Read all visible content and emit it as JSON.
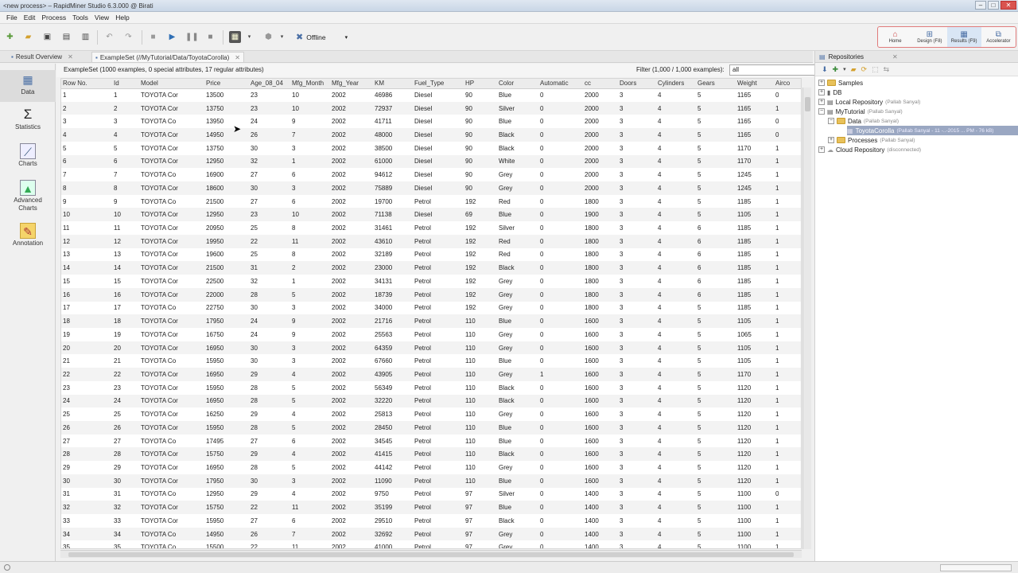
{
  "window": {
    "title": "<new process> – RapidMiner Studio 6.3.000 @ Birati"
  },
  "menu": [
    "File",
    "Edit",
    "Process",
    "Tools",
    "View",
    "Help"
  ],
  "toolbar": {
    "offline_label": "Offline"
  },
  "perspectives": [
    {
      "label": "Home",
      "icon": "home-icon"
    },
    {
      "label": "Design (F8)",
      "icon": "design-icon"
    },
    {
      "label": "Results (F9)",
      "icon": "results-icon"
    },
    {
      "label": "Accelerator",
      "icon": "accelerator-icon"
    }
  ],
  "tabs": [
    {
      "label": "Result Overview"
    },
    {
      "label": "ExampleSet (//MyTutorial/Data/ToyotaCorolla)"
    }
  ],
  "left_nav": [
    {
      "label": "Data",
      "icon": "data-icon"
    },
    {
      "label": "Statistics",
      "icon": "sigma-icon"
    },
    {
      "label": "Charts",
      "icon": "chart-icon"
    },
    {
      "label": "Advanced Charts",
      "icon": "advanced-chart-icon"
    },
    {
      "label": "Annotation",
      "icon": "annotation-icon"
    }
  ],
  "exampleset": {
    "info": "ExampleSet (1000 examples, 0 special attributes, 17 regular attributes)",
    "filter_label": "Filter (1,000 / 1,000 examples):",
    "filter_value": "all"
  },
  "table": {
    "columns": [
      "Row No.",
      "Id",
      "Model",
      "Price",
      "Age_08_04",
      "Mfg_Month",
      "Mfg_Year",
      "KM",
      "Fuel_Type",
      "HP",
      "Color",
      "Automatic",
      "cc",
      "Doors",
      "Cylinders",
      "Gears",
      "Weight",
      "Airco"
    ],
    "rows": [
      [
        "1",
        "1",
        "TOYOTA Cor",
        "13500",
        "23",
        "10",
        "2002",
        "46986",
        "Diesel",
        "90",
        "Blue",
        "0",
        "2000",
        "3",
        "4",
        "5",
        "1165",
        "0"
      ],
      [
        "2",
        "2",
        "TOYOTA Cor",
        "13750",
        "23",
        "10",
        "2002",
        "72937",
        "Diesel",
        "90",
        "Silver",
        "0",
        "2000",
        "3",
        "4",
        "5",
        "1165",
        "1"
      ],
      [
        "3",
        "3",
        "TOYOTA Co",
        "13950",
        "24",
        "9",
        "2002",
        "41711",
        "Diesel",
        "90",
        "Blue",
        "0",
        "2000",
        "3",
        "4",
        "5",
        "1165",
        "0"
      ],
      [
        "4",
        "4",
        "TOYOTA Cor",
        "14950",
        "26",
        "7",
        "2002",
        "48000",
        "Diesel",
        "90",
        "Black",
        "0",
        "2000",
        "3",
        "4",
        "5",
        "1165",
        "0"
      ],
      [
        "5",
        "5",
        "TOYOTA Cor",
        "13750",
        "30",
        "3",
        "2002",
        "38500",
        "Diesel",
        "90",
        "Black",
        "0",
        "2000",
        "3",
        "4",
        "5",
        "1170",
        "1"
      ],
      [
        "6",
        "6",
        "TOYOTA Cor",
        "12950",
        "32",
        "1",
        "2002",
        "61000",
        "Diesel",
        "90",
        "White",
        "0",
        "2000",
        "3",
        "4",
        "5",
        "1170",
        "1"
      ],
      [
        "7",
        "7",
        "TOYOTA Co",
        "16900",
        "27",
        "6",
        "2002",
        "94612",
        "Diesel",
        "90",
        "Grey",
        "0",
        "2000",
        "3",
        "4",
        "5",
        "1245",
        "1"
      ],
      [
        "8",
        "8",
        "TOYOTA Cor",
        "18600",
        "30",
        "3",
        "2002",
        "75889",
        "Diesel",
        "90",
        "Grey",
        "0",
        "2000",
        "3",
        "4",
        "5",
        "1245",
        "1"
      ],
      [
        "9",
        "9",
        "TOYOTA Co",
        "21500",
        "27",
        "6",
        "2002",
        "19700",
        "Petrol",
        "192",
        "Red",
        "0",
        "1800",
        "3",
        "4",
        "5",
        "1185",
        "1"
      ],
      [
        "10",
        "10",
        "TOYOTA Cor",
        "12950",
        "23",
        "10",
        "2002",
        "71138",
        "Diesel",
        "69",
        "Blue",
        "0",
        "1900",
        "3",
        "4",
        "5",
        "1105",
        "1"
      ],
      [
        "11",
        "11",
        "TOYOTA Cor",
        "20950",
        "25",
        "8",
        "2002",
        "31461",
        "Petrol",
        "192",
        "Silver",
        "0",
        "1800",
        "3",
        "4",
        "6",
        "1185",
        "1"
      ],
      [
        "12",
        "12",
        "TOYOTA Cor",
        "19950",
        "22",
        "11",
        "2002",
        "43610",
        "Petrol",
        "192",
        "Red",
        "0",
        "1800",
        "3",
        "4",
        "6",
        "1185",
        "1"
      ],
      [
        "13",
        "13",
        "TOYOTA Cor",
        "19600",
        "25",
        "8",
        "2002",
        "32189",
        "Petrol",
        "192",
        "Red",
        "0",
        "1800",
        "3",
        "4",
        "6",
        "1185",
        "1"
      ],
      [
        "14",
        "14",
        "TOYOTA Cor",
        "21500",
        "31",
        "2",
        "2002",
        "23000",
        "Petrol",
        "192",
        "Black",
        "0",
        "1800",
        "3",
        "4",
        "6",
        "1185",
        "1"
      ],
      [
        "15",
        "15",
        "TOYOTA Cor",
        "22500",
        "32",
        "1",
        "2002",
        "34131",
        "Petrol",
        "192",
        "Grey",
        "0",
        "1800",
        "3",
        "4",
        "6",
        "1185",
        "1"
      ],
      [
        "16",
        "16",
        "TOYOTA Cor",
        "22000",
        "28",
        "5",
        "2002",
        "18739",
        "Petrol",
        "192",
        "Grey",
        "0",
        "1800",
        "3",
        "4",
        "6",
        "1185",
        "1"
      ],
      [
        "17",
        "17",
        "TOYOTA Co",
        "22750",
        "30",
        "3",
        "2002",
        "34000",
        "Petrol",
        "192",
        "Grey",
        "0",
        "1800",
        "3",
        "4",
        "5",
        "1185",
        "1"
      ],
      [
        "18",
        "18",
        "TOYOTA Cor",
        "17950",
        "24",
        "9",
        "2002",
        "21716",
        "Petrol",
        "110",
        "Blue",
        "0",
        "1600",
        "3",
        "4",
        "5",
        "1105",
        "1"
      ],
      [
        "19",
        "19",
        "TOYOTA Cor",
        "16750",
        "24",
        "9",
        "2002",
        "25563",
        "Petrol",
        "110",
        "Grey",
        "0",
        "1600",
        "3",
        "4",
        "5",
        "1065",
        "1"
      ],
      [
        "20",
        "20",
        "TOYOTA Cor",
        "16950",
        "30",
        "3",
        "2002",
        "64359",
        "Petrol",
        "110",
        "Grey",
        "0",
        "1600",
        "3",
        "4",
        "5",
        "1105",
        "1"
      ],
      [
        "21",
        "21",
        "TOYOTA Co",
        "15950",
        "30",
        "3",
        "2002",
        "67660",
        "Petrol",
        "110",
        "Blue",
        "0",
        "1600",
        "3",
        "4",
        "5",
        "1105",
        "1"
      ],
      [
        "22",
        "22",
        "TOYOTA Cor",
        "16950",
        "29",
        "4",
        "2002",
        "43905",
        "Petrol",
        "110",
        "Grey",
        "1",
        "1600",
        "3",
        "4",
        "5",
        "1170",
        "1"
      ],
      [
        "23",
        "23",
        "TOYOTA Cor",
        "15950",
        "28",
        "5",
        "2002",
        "56349",
        "Petrol",
        "110",
        "Black",
        "0",
        "1600",
        "3",
        "4",
        "5",
        "1120",
        "1"
      ],
      [
        "24",
        "24",
        "TOYOTA Cor",
        "16950",
        "28",
        "5",
        "2002",
        "32220",
        "Petrol",
        "110",
        "Black",
        "0",
        "1600",
        "3",
        "4",
        "5",
        "1120",
        "1"
      ],
      [
        "25",
        "25",
        "TOYOTA Cor",
        "16250",
        "29",
        "4",
        "2002",
        "25813",
        "Petrol",
        "110",
        "Grey",
        "0",
        "1600",
        "3",
        "4",
        "5",
        "1120",
        "1"
      ],
      [
        "26",
        "26",
        "TOYOTA Cor",
        "15950",
        "28",
        "5",
        "2002",
        "28450",
        "Petrol",
        "110",
        "Blue",
        "0",
        "1600",
        "3",
        "4",
        "5",
        "1120",
        "1"
      ],
      [
        "27",
        "27",
        "TOYOTA Co",
        "17495",
        "27",
        "6",
        "2002",
        "34545",
        "Petrol",
        "110",
        "Blue",
        "0",
        "1600",
        "3",
        "4",
        "5",
        "1120",
        "1"
      ],
      [
        "28",
        "28",
        "TOYOTA Cor",
        "15750",
        "29",
        "4",
        "2002",
        "41415",
        "Petrol",
        "110",
        "Black",
        "0",
        "1600",
        "3",
        "4",
        "5",
        "1120",
        "1"
      ],
      [
        "29",
        "29",
        "TOYOTA Cor",
        "16950",
        "28",
        "5",
        "2002",
        "44142",
        "Petrol",
        "110",
        "Grey",
        "0",
        "1600",
        "3",
        "4",
        "5",
        "1120",
        "1"
      ],
      [
        "30",
        "30",
        "TOYOTA Cor",
        "17950",
        "30",
        "3",
        "2002",
        "11090",
        "Petrol",
        "110",
        "Blue",
        "0",
        "1600",
        "3",
        "4",
        "5",
        "1120",
        "1"
      ],
      [
        "31",
        "31",
        "TOYOTA Co",
        "12950",
        "29",
        "4",
        "2002",
        "9750",
        "Petrol",
        "97",
        "Silver",
        "0",
        "1400",
        "3",
        "4",
        "5",
        "1100",
        "0"
      ],
      [
        "32",
        "32",
        "TOYOTA Cor",
        "15750",
        "22",
        "11",
        "2002",
        "35199",
        "Petrol",
        "97",
        "Blue",
        "0",
        "1400",
        "3",
        "4",
        "5",
        "1100",
        "1"
      ],
      [
        "33",
        "33",
        "TOYOTA Cor",
        "15950",
        "27",
        "6",
        "2002",
        "29510",
        "Petrol",
        "97",
        "Black",
        "0",
        "1400",
        "3",
        "4",
        "5",
        "1100",
        "1"
      ],
      [
        "34",
        "34",
        "TOYOTA Co",
        "14950",
        "26",
        "7",
        "2002",
        "32692",
        "Petrol",
        "97",
        "Grey",
        "0",
        "1400",
        "3",
        "4",
        "5",
        "1100",
        "1"
      ],
      [
        "35",
        "35",
        "TOYOTA Co",
        "15500",
        "22",
        "11",
        "2002",
        "41000",
        "Petrol",
        "97",
        "Grey",
        "0",
        "1400",
        "3",
        "4",
        "5",
        "1100",
        "1"
      ]
    ]
  },
  "repositories": {
    "panel_title": "Repositories",
    "tree": [
      {
        "label": "Samples",
        "sub": ""
      },
      {
        "label": "DB",
        "sub": ""
      },
      {
        "label": "Local Repository",
        "sub": "(Pallab Sanyal)"
      },
      {
        "label": "MyTutorial",
        "sub": "(Pallab Sanyal)"
      },
      {
        "label": "Data",
        "sub": "(Pallab Sanyal)"
      },
      {
        "label": "ToyotaCorolla",
        "sub": "(Pallab Sanyal - 11 -..-2015 ... PM - 76 kB)"
      },
      {
        "label": "Processes",
        "sub": "(Pallab Sanyal)"
      },
      {
        "label": "Cloud Repository",
        "sub": "(disconnected)"
      }
    ]
  },
  "colors": {
    "accent": "#4a6fa5",
    "selection": "#9aa7c2",
    "perspective_border": "#e07b7b"
  }
}
